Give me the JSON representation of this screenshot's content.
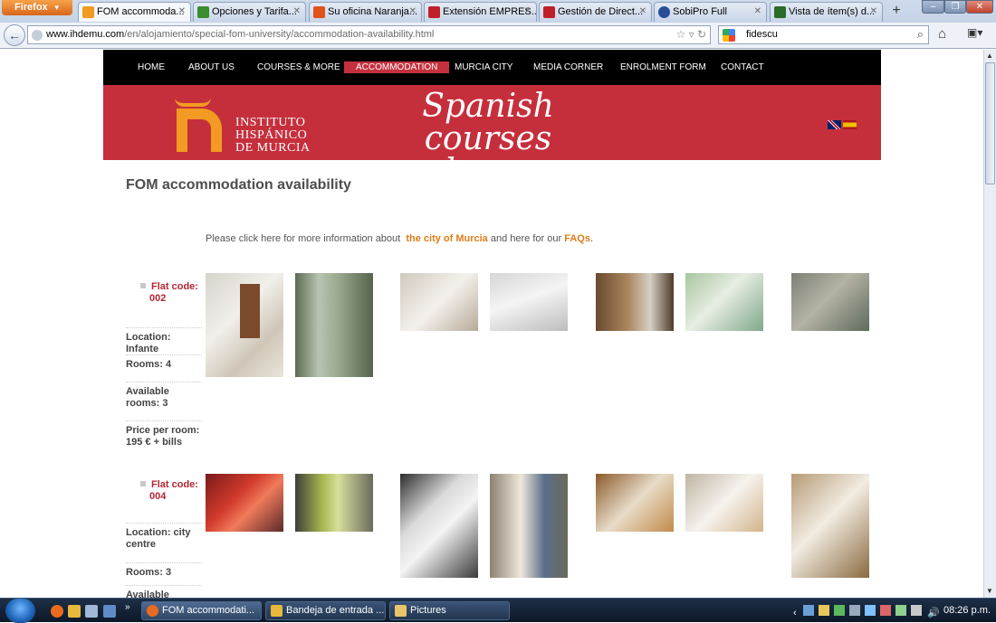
{
  "browser": {
    "menu_button": "Firefox",
    "tabs": [
      {
        "label": "FOM accommoda...",
        "active": true,
        "favicon_color": "#f29a21"
      },
      {
        "label": "Opciones y Tarifa...",
        "active": false,
        "favicon_color": "#3a8c2e"
      },
      {
        "label": "Su oficina Naranja...",
        "active": false,
        "favicon_color": "#e0521a"
      },
      {
        "label": "Extensión EMPRES...",
        "active": false,
        "favicon_color": "#c01f2a"
      },
      {
        "label": "Gestión de Direct...",
        "active": false,
        "favicon_color": "#c01f2a"
      },
      {
        "label": "SobiPro Full",
        "active": false,
        "favicon_color": "#2a4d96"
      },
      {
        "label": "Vista de ítem(s) d...",
        "active": false,
        "favicon_color": "#2a6b2a"
      }
    ],
    "url_domain": "www.ihdemu.com",
    "url_path": "/en/alojamiento/special-fom-university/accommodation-availability.html",
    "search_value": "fidescu"
  },
  "site": {
    "nav": [
      "HOME",
      "ABOUT US",
      "COURSES & MORE",
      "ACCOMMODATION",
      "MURCIA CITY",
      "MEDIA CORNER",
      "ENROLMENT FORM",
      "CONTACT"
    ],
    "logo_line1": "INSTITUTO",
    "logo_line2": "HISPÁNICO",
    "logo_line3": "DE MURCIA",
    "slogan_line1": "Spanish courses",
    "slogan_line2": "and more...",
    "colors": {
      "banner": "#c52f3c",
      "accent": "#f29a21",
      "link": "#e07d1a"
    }
  },
  "page": {
    "title": "FOM accommodation availability",
    "intro_before": "Please click here for more information about ",
    "intro_link1": "the city of Murcia",
    "intro_middle": " and here for our ",
    "intro_link2": "FAQs",
    "intro_after": "."
  },
  "flats": [
    {
      "code_label": "Flat code:",
      "code": "002",
      "location": "Location: Infante",
      "rooms": "Rooms: 4",
      "available": "Available rooms: 3",
      "price": "Price per room: 195 € + bills"
    },
    {
      "code_label": "Flat code:",
      "code": "004",
      "location": "Location: city centre",
      "rooms": "Rooms: 3",
      "available": "Available rooms:",
      "price": ""
    }
  ],
  "taskbar": {
    "items": [
      {
        "label": "FOM accommodati...",
        "icon_color": "#e86b1f"
      },
      {
        "label": "Bandeja de entrada ...",
        "icon_color": "#e8b83c"
      },
      {
        "label": "Pictures",
        "icon_color": "#e9c46a"
      }
    ],
    "clock": "08:26 p.m."
  }
}
